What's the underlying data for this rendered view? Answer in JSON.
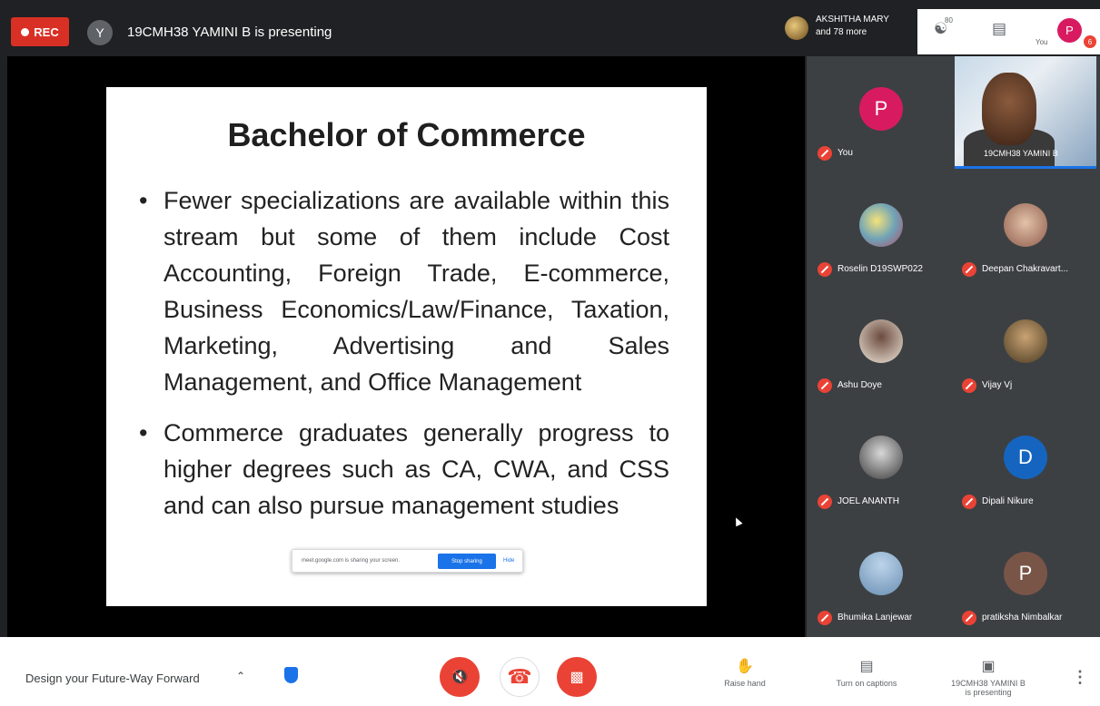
{
  "topbar": {
    "rec_label": "REC",
    "presenter_initial": "Y",
    "presenter_text": "19CMH38 YAMINI B is presenting",
    "participants_line1": "AKSHITHA MARY",
    "participants_line2": "and 78 more",
    "people_count": "80",
    "you_label": "You",
    "you_initial": "P",
    "notif_count": "6"
  },
  "slide": {
    "title": "Bachelor of Commerce",
    "bullets": [
      "Fewer specializations are available within this stream but some of them include Cost Accounting, Foreign Trade, E-commerce, Business Economics/Law/Finance, Taxation, Marketing, Advertising and Sales Management, and Office Management",
      "Commerce graduates generally progress to higher degrees such as CA, CWA, and CSS and can also pursue management studies"
    ],
    "share_bar": {
      "text": "meet.google.com is sharing your screen.",
      "stop_label": "Stop sharing",
      "hide_label": "Hide"
    }
  },
  "grid": {
    "tiles": [
      {
        "name": "You",
        "initial": "P",
        "color": "#d81b60"
      },
      {
        "name": "Roselin D19SWP022",
        "initial": "",
        "color": "#c9a23c"
      },
      {
        "name": "Deepan Chakravart...",
        "initial": "",
        "color": "#8d5b4c"
      },
      {
        "name": "Ashu Doye",
        "initial": "",
        "color": "#e6d6c8"
      },
      {
        "name": "Vijay Vj",
        "initial": "",
        "color": "#6b5a3a"
      },
      {
        "name": "JOEL ANANTH",
        "initial": "",
        "color": "#4a4a4a"
      },
      {
        "name": "Dipali Nikure",
        "initial": "D",
        "color": "#1565c0"
      },
      {
        "name": "Bhumika Lanjewar",
        "initial": "",
        "color": "#7ba3c8"
      },
      {
        "name": "pratiksha Nimbalkar",
        "initial": "P",
        "color": "#795548"
      }
    ],
    "video_name": "19CMH38 YAMINI B"
  },
  "bottombar": {
    "meeting_title": "Design your Future-Way Forward",
    "raise_hand": "Raise hand",
    "captions": "Turn on captions",
    "presenting_line1": "19CMH38 YAMINI B",
    "presenting_line2": "is presenting"
  },
  "colors": {
    "accent_red": "#ea4335",
    "accent_blue": "#1a73e8",
    "background": "#202124"
  }
}
